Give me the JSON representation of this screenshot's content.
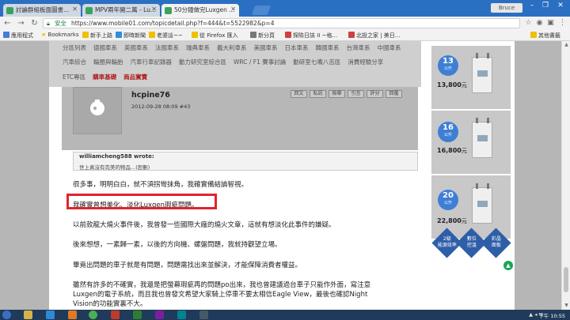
{
  "tabs": [
    {
      "label": "討論群組板面圖書...",
      "color": "#3aa35b"
    },
    {
      "label": "MPV兩年開二萬 - Lu...",
      "color": "#3aa35b"
    },
    {
      "label": "50分鐘做完Luxgen ...",
      "color": "#3aa35b"
    }
  ],
  "browser": {
    "profile": "Bruce",
    "secure_label": "安全",
    "url": "https://www.mobile01.com/topicdetail.php?f=444&t=5522982&p=4"
  },
  "bookmarks": [
    {
      "label": "應用程式",
      "color": "#4a7ad8"
    },
    {
      "label": "Bookmarks",
      "color": "#f0c000"
    },
    {
      "label": "新手上路",
      "color": "#f0c000"
    },
    {
      "label": "即時新聞",
      "color": "#2d8fe0"
    },
    {
      "label": "老婆這~~",
      "color": "#f0c000"
    },
    {
      "label": "從 Firefox 匯入",
      "color": "#f0c000"
    },
    {
      "label": "新分頁",
      "color": "#777777"
    },
    {
      "label": "探險日誌 II ~格...",
      "color": "#d04040"
    },
    {
      "label": "北投之家 | 美日...",
      "color": "#d04040"
    },
    {
      "label": "其他書籤",
      "color": "#f0c000"
    }
  ],
  "categories": {
    "row1": [
      "分區列表",
      "德國車系",
      "英國車系",
      "法國車系",
      "瑞典車系",
      "義大利車系",
      "美國車系",
      "日本車系",
      "韓國車系",
      "台灣車系",
      "中國車系"
    ],
    "row2": [
      "汽車綜合",
      "輪圈與輪胎",
      "汽車行車記錄器",
      "動力研究室綜合區",
      "WRC / F1 賽事討論",
      "動研室七嘴八舌區",
      "消費經驗分享"
    ],
    "row3": [
      "ETC專區",
      "購車基礎",
      "商品實賣"
    ]
  },
  "post": {
    "username": "hcpine76",
    "date": "2012-09-28 08:09",
    "floor": "#43",
    "buttons": [
      "回文",
      "私訊",
      "檢舉",
      "引言",
      "評分",
      "回覆"
    ],
    "quote_author": "williamcheng588 wrote:",
    "quote_body": "世上真沒有完美的物品...(恕刪)",
    "paragraphs": [
      "很多事，明明白白，就不須拐彎抹角，我確實備結論智視。",
      "我確實曾想美化、淡化Luxgen瑕疵問題。",
      "以前款龍大燒火事件後，我曾發一些國際大廠的燒火文章，這就有想淡化此事件的嫌疑。",
      "後來想想，一素歸一素，以後的方向機、螺盤問題，我就持觀望立場。",
      "畢竟出問題的車子就是有問題，問題需找出來並解決，才能保障消費者權益。",
      "雖然有許多的不確實，我還是把螢幕瑕疵再的問題po出來，我也曾建議過台車子只能作外面，寫注意",
      "Luxgen的電子系統，而且我也曾發文希望大家騎上停車不要太相信Eagle View，最後也確認Night",
      "Vision的功能實裏不大。"
    ]
  },
  "ads": [
    {
      "capacity": "13",
      "unit": "公升",
      "price": "13,800",
      "currency": "元"
    },
    {
      "capacity": "16",
      "unit": "公升",
      "price": "16,800",
      "currency": "元"
    },
    {
      "capacity": "20",
      "unit": "公升",
      "price": "22,800",
      "currency": "元"
    }
  ],
  "ad_cubes": [
    "2級\n能源效率",
    "數位\n控溫",
    "彩晶\n面板"
  ],
  "taskbar": {
    "clock": "下午 10:55"
  }
}
